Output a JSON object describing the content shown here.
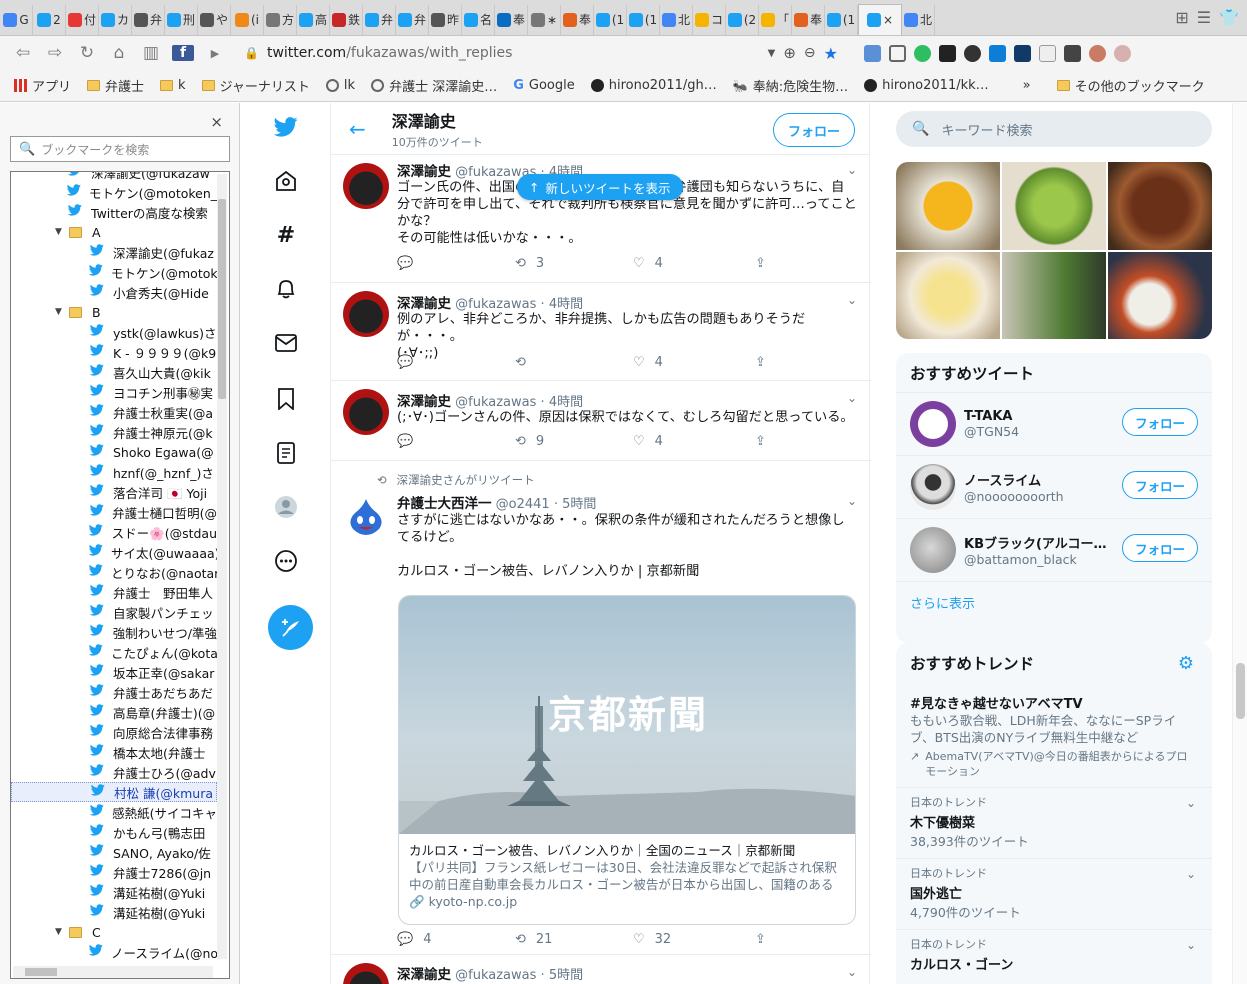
{
  "tabs": {
    "items": [
      {
        "label": "G",
        "color": "#4285f4"
      },
      {
        "label": "2",
        "color": "#1da1f2"
      },
      {
        "label": "付",
        "color": "#e53935"
      },
      {
        "label": "カ",
        "color": "#1da1f2"
      },
      {
        "label": "弁",
        "color": "#555555"
      },
      {
        "label": "刑",
        "color": "#1da1f2"
      },
      {
        "label": "や",
        "color": "#555555"
      },
      {
        "label": "(i",
        "color": "#ef8a1a"
      },
      {
        "label": "方",
        "color": "#777777"
      },
      {
        "label": "高",
        "color": "#1da1f2"
      },
      {
        "label": "鉄",
        "color": "#c62828"
      },
      {
        "label": "弁",
        "color": "#1da1f2"
      },
      {
        "label": "弁",
        "color": "#1da1f2"
      },
      {
        "label": "昨",
        "color": "#555555"
      },
      {
        "label": "名",
        "color": "#1da1f2"
      },
      {
        "label": "奉",
        "color": "#0a6cc2"
      },
      {
        "label": "∗",
        "color": "#777777"
      },
      {
        "label": "奉",
        "color": "#e2611f"
      },
      {
        "label": "(1",
        "color": "#1da1f2"
      },
      {
        "label": "(1",
        "color": "#1da1f2"
      },
      {
        "label": "北",
        "color": "#4285f4"
      },
      {
        "label": "コ",
        "color": "#f4b400"
      },
      {
        "label": "(2",
        "color": "#1da1f2"
      },
      {
        "label": "「",
        "color": "#f4b400"
      },
      {
        "label": "奉",
        "color": "#e2611f"
      },
      {
        "label": "(1",
        "color": "#1da1f2"
      }
    ],
    "active": {
      "label": "×",
      "color": "#1da1f2"
    },
    "after": {
      "label": "北",
      "color": "#4285f4"
    }
  },
  "toolbar": {
    "url_domain": "twitter.com",
    "url_path": "/fukazawas/with_replies"
  },
  "bookmarks_bar": {
    "items": [
      {
        "label": "アプリ",
        "icon": "apps-icon"
      },
      {
        "label": "弁護士",
        "icon": "folder-icon"
      },
      {
        "label": "k",
        "icon": "folder-icon"
      },
      {
        "label": "ジャーナリスト",
        "icon": "folder-icon"
      },
      {
        "label": "lk",
        "icon": "globe-icon"
      },
      {
        "label": "弁護士 深澤諭史…",
        "icon": "globe-icon"
      },
      {
        "label": "Google",
        "icon": "google-icon"
      },
      {
        "label": "hirono2011/gh…",
        "icon": "github-icon"
      },
      {
        "label": "奉納:危険生物…",
        "icon": "bug-icon"
      },
      {
        "label": "hirono2011/kk…",
        "icon": "github-icon"
      }
    ],
    "more": "»",
    "other": "その他のブックマーク"
  },
  "side_panel": {
    "search_placeholder": "ブックマークを検索",
    "close": "×",
    "rows": [
      {
        "text": "深澤諭史(@fukazaw",
        "type": "item"
      },
      {
        "text": "モトケン(@motoken_",
        "type": "item"
      },
      {
        "text": "Twitterの高度な検索",
        "type": "item"
      },
      {
        "text": "A",
        "type": "folder"
      },
      {
        "text": "深澤諭史(@fukaz",
        "type": "sub"
      },
      {
        "text": "モトケン(@motok",
        "type": "sub"
      },
      {
        "text": "小倉秀夫(@Hide",
        "type": "sub"
      },
      {
        "text": "B",
        "type": "folder"
      },
      {
        "text": "ystk(@lawkus)さ",
        "type": "sub"
      },
      {
        "text": "K - ９９９９(@k9",
        "type": "sub"
      },
      {
        "text": "喜久山大貴(@kik",
        "type": "sub"
      },
      {
        "text": "ヨコチン刑事㊙実",
        "type": "sub"
      },
      {
        "text": "弁護士秋重実(@a",
        "type": "sub"
      },
      {
        "text": "弁護士神原元(@k",
        "type": "sub"
      },
      {
        "text": "Shoko Egawa(@",
        "type": "sub"
      },
      {
        "text": "hznf(@_hznf_)さ",
        "type": "sub"
      },
      {
        "text": "落合洋司 🇯🇵 Yoji",
        "type": "sub"
      },
      {
        "text": "弁護士樋口哲明(@",
        "type": "sub"
      },
      {
        "text": "スドー🌸(@stdau",
        "type": "sub"
      },
      {
        "text": "サイ太(@uwaaaa)",
        "type": "sub"
      },
      {
        "text": "とりなお(@naotar",
        "type": "sub"
      },
      {
        "text": "弁護士　野田隼人",
        "type": "sub"
      },
      {
        "text": "自家製パンチェッ",
        "type": "sub"
      },
      {
        "text": "強制わいせつ/準強",
        "type": "sub"
      },
      {
        "text": "こたぴょん(@kota",
        "type": "sub"
      },
      {
        "text": "坂本正幸(@sakar",
        "type": "sub"
      },
      {
        "text": "弁護士あだちあだ",
        "type": "sub"
      },
      {
        "text": "高島章(弁護士)(@",
        "type": "sub"
      },
      {
        "text": "向原総合法律事務",
        "type": "sub"
      },
      {
        "text": "橋本太地(弁護士",
        "type": "sub"
      },
      {
        "text": "弁護士ひろ(@adv",
        "type": "sub"
      },
      {
        "text": "村松 謙(@kmura",
        "type": "sel"
      },
      {
        "text": "感熱紙(サイコキャ",
        "type": "sub"
      },
      {
        "text": "かもん弓(鴨志田",
        "type": "sub"
      },
      {
        "text": "SANO, Ayako/佐",
        "type": "sub"
      },
      {
        "text": "弁護士7286(@jn",
        "type": "sub"
      },
      {
        "text": "溝延祐樹(@Yuki",
        "type": "sub"
      },
      {
        "text": "溝延祐樹(@Yuki",
        "type": "sub"
      },
      {
        "text": "C",
        "type": "folder"
      },
      {
        "text": "ノースライム(@no",
        "type": "sub"
      }
    ]
  },
  "profile": {
    "name": "深澤諭史",
    "tweet_count": "10万件のツイート",
    "follow": "フォロー",
    "new_tweets": "新しいツイートを表示"
  },
  "tweets": [
    {
      "name": "深澤諭史",
      "handle": "@fukazawas",
      "time": "4時間",
      "text": "ゴーン氏の件、出国の申請があったとしたら、弁護団も知らないうちに、自分で許可を申し出て、それで裁判所も検察官に意見を聞かずに許可…ってことかな？\nその可能性は低いかな・・・。",
      "replies": "",
      "retweets": "3",
      "likes": "4"
    },
    {
      "name": "深澤諭史",
      "handle": "@fukazawas",
      "time": "4時間",
      "text": "例のアレ、非弁どころか、非弁提携、しかも広告の問題もありそうだが・・・。\n(･∀･;;)",
      "replies": "",
      "retweets": "",
      "likes": "4"
    },
    {
      "name": "深澤諭史",
      "handle": "@fukazawas",
      "time": "4時間",
      "text": "(;･∀･)ゴーンさんの件、原因は保釈ではなくて、むしろ勾留だと思っている。",
      "replies": "",
      "retweets": "9",
      "likes": "4"
    },
    {
      "retweeted_by": "深澤諭史さんがリツイート",
      "name": "弁護士大西洋一",
      "handle": "@o2441",
      "time": "5時間",
      "text": "さすがに逃亡はないかなあ・・。保釈の条件が緩和されたんだろうと想像してるけど。\n\nカルロス・ゴーン被告、レバノン入りか | 京都新聞",
      "card": {
        "logo": "京都新聞",
        "title": "カルロス・ゴーン被告、レバノン入りか｜全国のニュース｜京都新聞",
        "desc": "【パリ共同】フランス紙レゼコーは30日、会社法違反罪などで起訴され保釈中の前日産自動車会長カルロス・ゴーン被告が日本から出国し、国籍のあるレ…",
        "link": "kyoto-np.co.jp"
      },
      "replies": "4",
      "retweets": "21",
      "likes": "32"
    },
    {
      "name": "深澤諭史",
      "handle": "@fukazawas",
      "time": "5時間"
    }
  ],
  "search": {
    "placeholder": "キーワード検索"
  },
  "who_to_follow": {
    "title": "おすすめツイート",
    "users": [
      {
        "name": "T-TAKA",
        "handle": "@TGN54",
        "button": "フォロー"
      },
      {
        "name": "ノースライム",
        "handle": "@noooooooorth",
        "button": "フォロー"
      },
      {
        "name": "KBブラック(アルコール…",
        "handle": "@battamon_black",
        "button": "フォロー"
      }
    ],
    "more": "さらに表示"
  },
  "trends": {
    "title": "おすすめトレンド",
    "promoted": {
      "name": "#見なきゃ越せないアベマTV",
      "desc": "ももいろ歌合戦、LDH新年会、ななにーSPライブ、BTS出演のNYライブ無料生中継など",
      "promo": "AbemaTV(アベマTV)@今日の番組表からによるプロモーション"
    },
    "items": [
      {
        "context": "日本のトレンド",
        "name": "木下優樹菜",
        "count": "38,393件のツイート"
      },
      {
        "context": "日本のトレンド",
        "name": "国外逃亡",
        "count": "4,790件のツイート"
      },
      {
        "context": "日本のトレンド",
        "name": "カルロス・ゴーン",
        "count": ""
      }
    ]
  }
}
